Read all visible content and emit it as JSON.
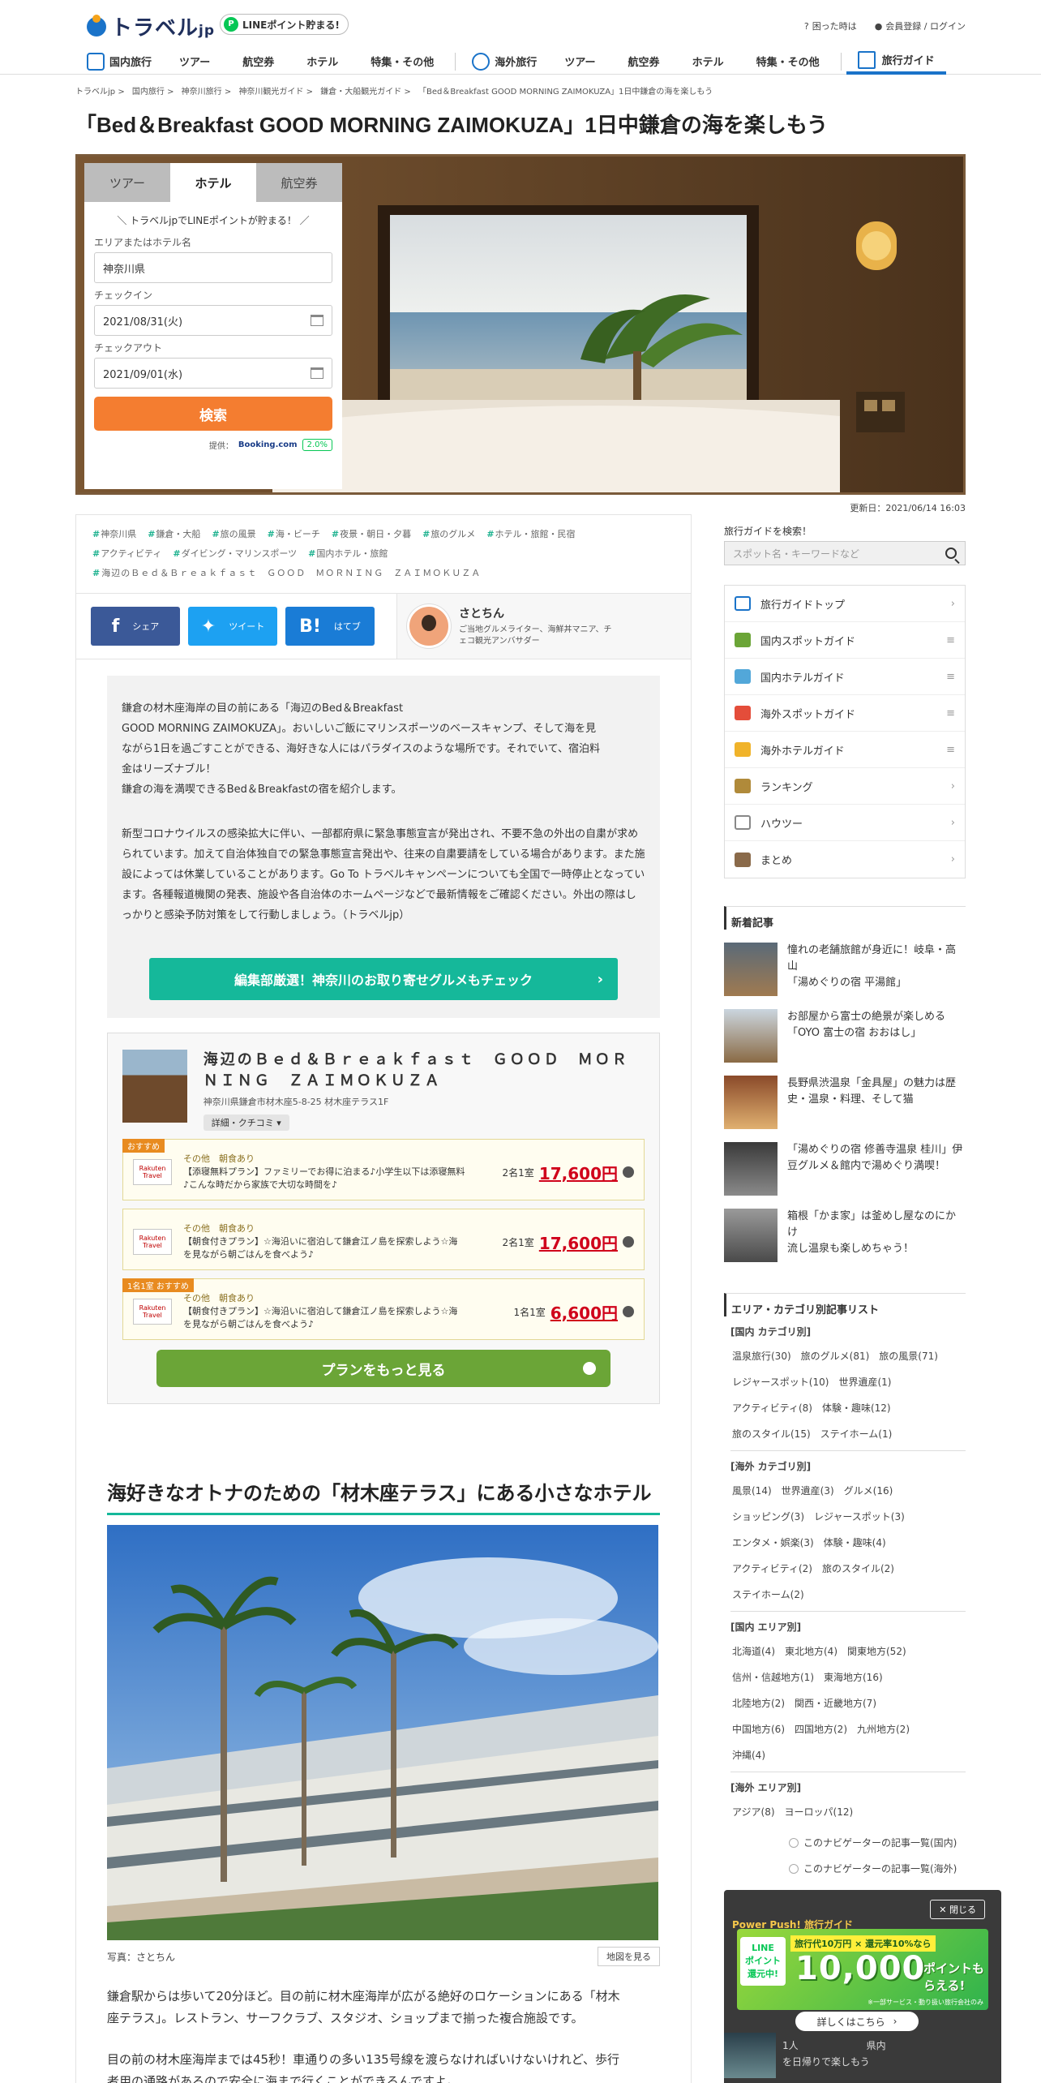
{
  "header": {
    "logo": "トラベル",
    "logo_suffix": "jp",
    "line_pill": "LINEポイント貯まる!",
    "help": "困った時は",
    "login": "会員登録 / ログイン"
  },
  "nav": {
    "domestic": "国内旅行",
    "tour": "ツアー",
    "air": "航空券",
    "hotel": "ホテル",
    "special": "特集・その他",
    "overseas": "海外旅行",
    "tour2": "ツアー",
    "air2": "航空券",
    "hotel2": "ホテル",
    "special2": "特集・その他",
    "guide": "旅行ガイド"
  },
  "breadcrumb": [
    "トラベルjp",
    "国内旅行",
    "神奈川旅行",
    "神奈川観光ガイド",
    "鎌倉・大船観光ガイド",
    "「Bed＆Breakfast GOOD MORNING ZAIMOKUZA」1日中鎌倉の海を楽しもう"
  ],
  "title": "「Bed＆Breakfast GOOD MORNING ZAIMOKUZA」1日中鎌倉の海を楽しもう",
  "booking": {
    "tabs": [
      "ツアー",
      "ホテル",
      "航空券"
    ],
    "promo": "＼ トラベルjpでLINEポイントが貯まる！ ／",
    "area_label": "エリアまたはホテル名",
    "area_value": "神奈川県",
    "checkin_label": "チェックイン",
    "checkin_value": "2021/08/31(火)",
    "checkout_label": "チェックアウト",
    "checkout_value": "2021/09/01(水)",
    "search": "検索",
    "provider": "提供：",
    "provider_name": "Booking.com",
    "points": "2.0%"
  },
  "updated": "更新日：2021/06/14 16:03",
  "tags": [
    "神奈川県",
    "鎌倉・大船",
    "旅の風景",
    "海・ビーチ",
    "夜景・朝日・夕暮",
    "旅のグルメ",
    "ホテル・旅館・民宿",
    "アクティビティ",
    "ダイビング・マリンスポーツ",
    "国内ホテル・旅館",
    "海辺のＢｅｄ＆Ｂｒｅａｋｆａｓｔ　ＧＯＯＤ　ＭＯＲＮＩＮＧ　ＺＡＩＭＯＫＵＺＡ"
  ],
  "share": {
    "fb": "シェア",
    "tw": "ツイート",
    "hb": "はてブ"
  },
  "author": {
    "name": "さとちん",
    "desc1": "ご当地グルメライター、海鮮丼マニア、チ",
    "desc2": "ェコ観光アンバサダー"
  },
  "intro": {
    "p1": "鎌倉の材木座海岸の目の前にある「海辺のBed＆Breakfast",
    "p2": "GOOD MORNING ZAIMOKUZA」。おいしいご飯にマリンスポーツのベースキャンプ、そして海を見",
    "p3": "ながら1日を過ごすことができる、海好きな人にはパラダイスのような場所です。それでいて、宿泊料",
    "p4": "金はリーズナブル！",
    "p5": "鎌倉の海を満喫できるBed＆Breakfastの宿を紹介します。",
    "caution": "新型コロナウイルスの感染拡大に伴い、一部都府県に緊急事態宣言が発出され、不要不急の外出の自粛が求められています。加えて自治体独自での緊急事態宣言発出や、往来の自粛要請をしている場合があります。また施設によっては休業していることがあります。Go To トラベルキャンペーンについても全国で一時停止となっています。各種報道機関の発表、施設や各自治体のホームページなどで最新情報をご確認ください。外出の際はしっかりと感染予防対策をして行動しましょう。（トラベルjp）",
    "button": "編集部厳選！神奈川のお取り寄せグルメもチェック"
  },
  "hotel": {
    "name": "海辺のＢｅｄ＆Ｂｒｅａｋｆａｓｔ　ＧＯＯＤ　ＭＯＲＮＩＮＧ　ＺＡＩＭＯＫＵＺＡ",
    "address": "神奈川県鎌倉市材木座5-8-25 材木座テラス1F",
    "detail": "詳細・クチコミ",
    "plans": [
      {
        "badge": "おすすめ",
        "logo": "Rakuten Travel",
        "meal": "その他　朝食あり",
        "desc1": "【添寝無料プラン】ファミリーでお得に泊まる♪小学生以下は添寝無料",
        "desc2": "♪こんな時だから家族で大切な時間を♪",
        "unit": "2名1室",
        "price": "17,600円"
      },
      {
        "badge": "",
        "logo": "Rakuten Travel",
        "meal": "その他　朝食あり",
        "desc1": "【朝食付きプラン】☆海沿いに宿泊して鎌倉江ノ島を探索しよう☆海",
        "desc2": "を見ながら朝ごはんを食べよう♪",
        "unit": "2名1室",
        "price": "17,600円"
      },
      {
        "badge": "1名1室 おすすめ",
        "logo": "Rakuten Travel",
        "meal": "その他　朝食あり",
        "desc1": "【朝食付きプラン】☆海沿いに宿泊して鎌倉江ノ島を探索しよう☆海",
        "desc2": "を見ながら朝ごはんを食べよう♪",
        "unit": "1名1室",
        "price": "6,600円"
      }
    ],
    "more": "プランをもっと見る"
  },
  "section": {
    "h2": "海好きなオトナのための「材木座テラス」にある小さなホテル",
    "caption": "写真：さとちん",
    "map": "地図を見る",
    "p1a": "鎌倉駅からは歩いて20分ほど。目の前に材木座海岸が広がる絶好のロケーションにある「材木",
    "p1b": "座テラス」。レストラン、サーフクラブ、スタジオ、ショップまで揃った複合施設です。",
    "p2a": "目の前の材木座海岸までは45秒！車通りの多い135号線を渡らなければいけないけれど、歩行",
    "p2b": "者用の通路があるので安全に海まで行くことができるんですよ。"
  },
  "sidebar": {
    "search_label": "旅行ガイドを検索！",
    "search_placeholder": "スポット名・キーワードなど",
    "menu": [
      "旅行ガイドトップ",
      "国内スポットガイド",
      "国内ホテルガイド",
      "海外スポットガイド",
      "海外ホテルガイド",
      "ランキング",
      "ハウツー",
      "まとめ"
    ],
    "new_title": "新着記事",
    "new": [
      {
        "l1": "憧れの老舗旅館が身近に！岐阜・高山",
        "l2": "「湯めぐりの宿 平湯館」"
      },
      {
        "l1": "お部屋から富士の絶景が楽しめる",
        "l2": "「OYO 富士の宿 おおはし」"
      },
      {
        "l1": "長野県渋温泉「金具屋」の魅力は歴",
        "l2": "史・温泉・料理、そして猫"
      },
      {
        "l1": "「湯めぐりの宿 修善寺温泉 桂川」伊",
        "l2": "豆グルメ＆館内で湯めぐり満喫！"
      },
      {
        "l1": "箱根「かま家」は釜めし屋なのにかけ",
        "l2": "流し温泉も楽しめちゃう！"
      }
    ],
    "cat_title": "エリア・カテゴリ別記事リスト",
    "dom_cat": "[国内 カテゴリ別]",
    "dom_cat_rows": [
      [
        "温泉旅行(30)",
        "旅のグルメ(81)",
        "旅の風景(71)"
      ],
      [
        "レジャースポット(10)",
        "世界遺産(1)"
      ],
      [
        "アクティビティ(8)",
        "体験・趣味(12)"
      ],
      [
        "旅のスタイル(15)",
        "ステイホーム(1)"
      ]
    ],
    "ovs_cat": "[海外 カテゴリ別]",
    "ovs_cat_rows": [
      [
        "風景(14)",
        "世界遺産(3)",
        "グルメ(16)"
      ],
      [
        "ショッピング(3)",
        "レジャースポット(3)"
      ],
      [
        "エンタメ・娯楽(3)",
        "体験・趣味(4)"
      ],
      [
        "アクティビティ(2)",
        "旅のスタイル(2)"
      ],
      [
        "ステイホーム(2)"
      ]
    ],
    "dom_area": "[国内 エリア別]",
    "dom_area_rows": [
      [
        "北海道(4)",
        "東北地方(4)",
        "関東地方(52)"
      ],
      [
        "信州・信越地方(1)",
        "東海地方(16)"
      ],
      [
        "北陸地方(2)",
        "関西・近畿地方(7)"
      ],
      [
        "中国地方(6)",
        "四国地方(2)",
        "九州地方(2)"
      ],
      [
        "沖縄(4)"
      ]
    ],
    "ovs_area": "[海外 エリア別]",
    "ovs_area_rows": [
      [
        "アジア(8)",
        "ヨーロッパ(12)"
      ]
    ],
    "nav_dom": "このナビゲーターの記事一覧(国内)",
    "nav_ovs": "このナビゲーターの記事一覧(海外)"
  },
  "popup": {
    "close": "閉じる",
    "title": "Power Push! 旅行ガイド",
    "line1": "LINE",
    "line2": "ポイント",
    "line3": "還元中!",
    "top": "旅行代10万円 × 還元率10%なら",
    "big": "10,000",
    "big_suffix": "ポイントもらえる!",
    "small": "※一部サービス・動り扱い旅行会社のみ",
    "detail": "詳しくはこちら",
    "art1": "1人　　　　　　　県内",
    "art2": "を日帰りで楽しもう"
  },
  "colors": {
    "accent": "#15b89a",
    "brand": "#1a73c9",
    "search": "#f47d30",
    "more": "#6ba537",
    "price": "#d0021b"
  }
}
